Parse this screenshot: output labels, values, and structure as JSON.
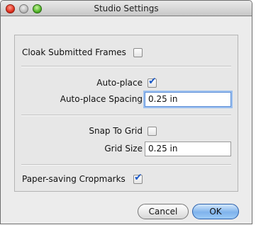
{
  "window": {
    "title": "Studio Settings"
  },
  "settings": {
    "cloak": {
      "label": "Cloak Submitted Frames",
      "checked": false
    },
    "autoplace": {
      "label": "Auto-place",
      "checked": true
    },
    "autoplace_spacing": {
      "label": "Auto-place Spacing",
      "value": "0.25 in"
    },
    "snap": {
      "label": "Snap To Grid",
      "checked": false
    },
    "grid_size": {
      "label": "Grid Size",
      "value": "0.25 in"
    },
    "cropmarks": {
      "label": "Paper-saving Cropmarks",
      "checked": true
    }
  },
  "buttons": {
    "cancel": "Cancel",
    "ok": "OK"
  },
  "icons": {
    "checkmark": "✔"
  }
}
